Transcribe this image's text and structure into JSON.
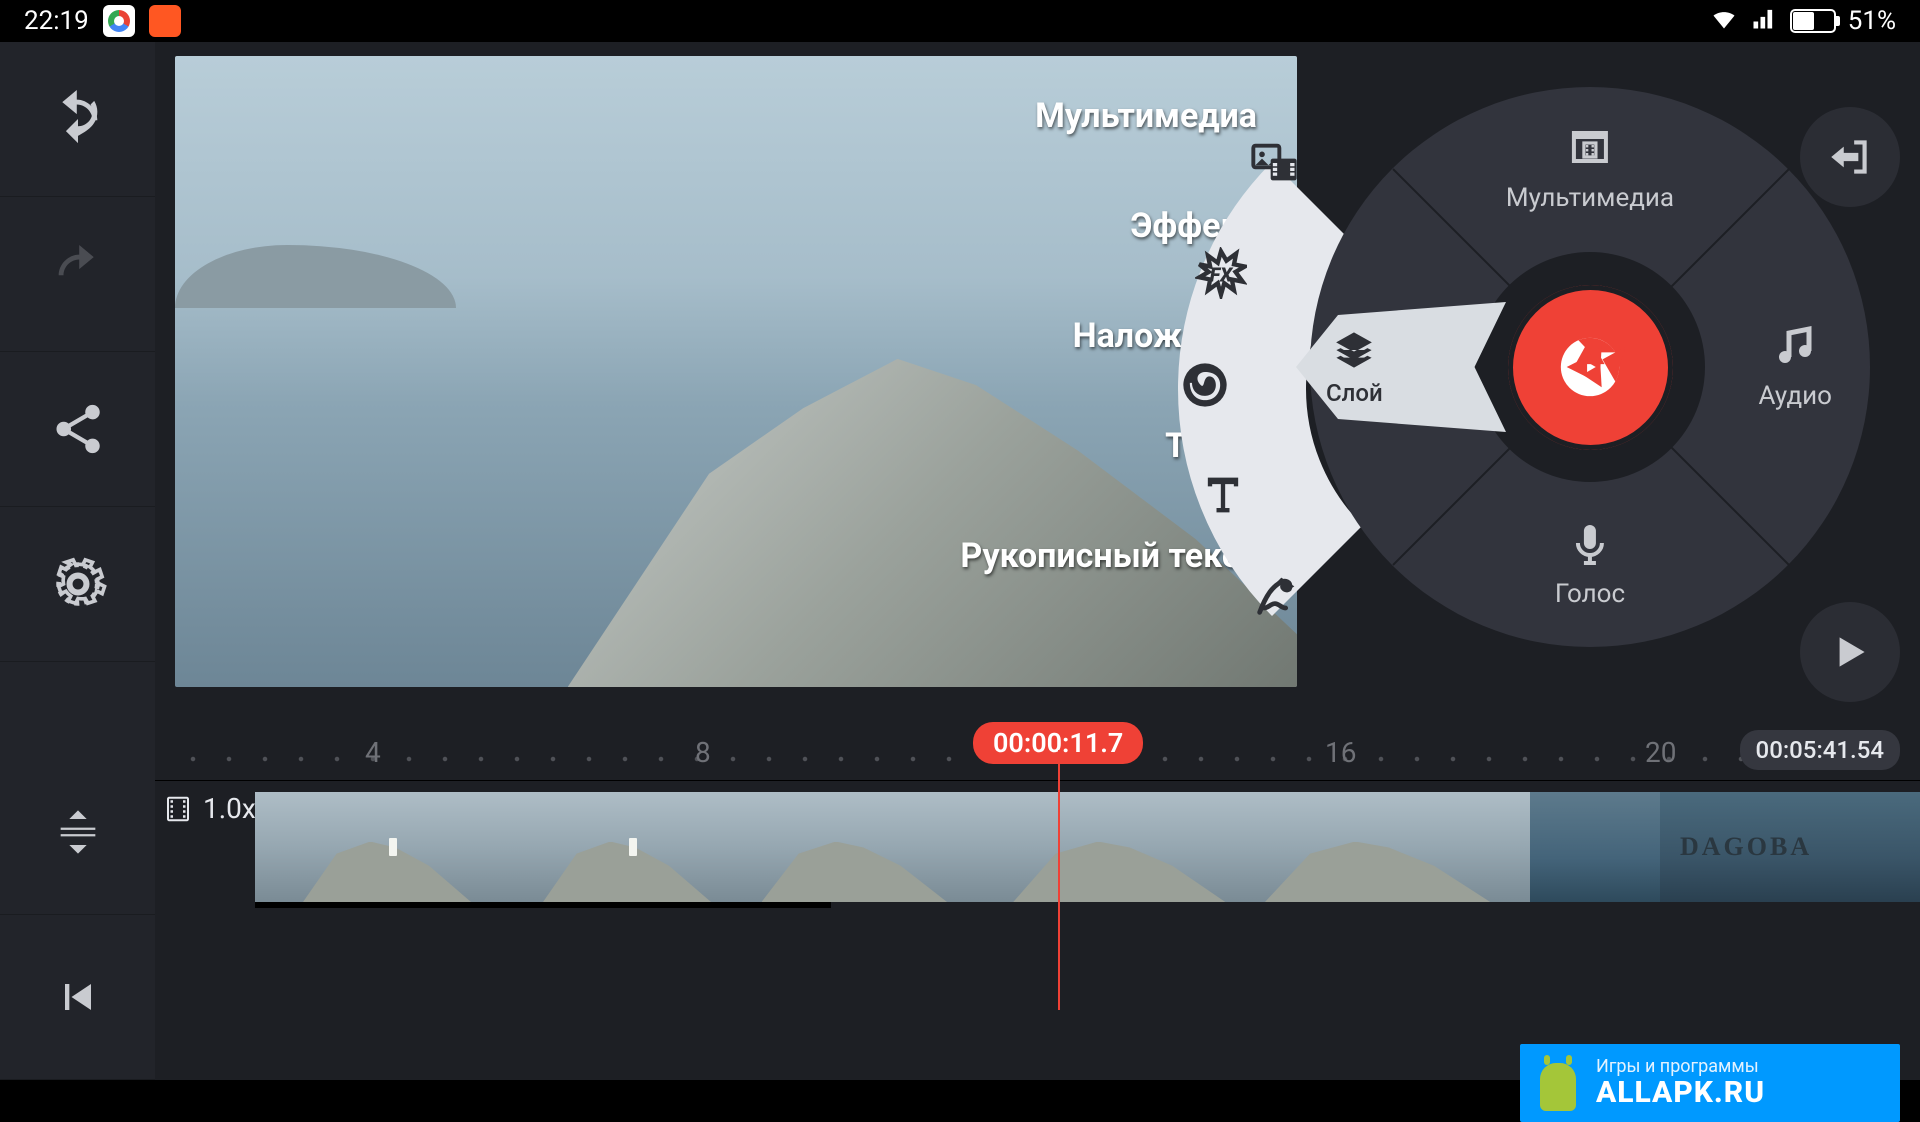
{
  "status_bar": {
    "time": "22:19",
    "battery": "51%"
  },
  "overlay_labels": {
    "multimedia": "Мультимедиа",
    "effect": "Эффект",
    "overlay": "Наложение",
    "text": "Текст",
    "handwriting": "Рукописный текст"
  },
  "wheel": {
    "multimedia": "Мультимедиа",
    "layer": "Слой",
    "audio": "Аудио",
    "voice": "Голос"
  },
  "timeline": {
    "ruler_marks": [
      "4",
      "8",
      "16",
      "20"
    ],
    "playhead_time": "00:00:11.7",
    "total_duration": "00:05:41.54",
    "speed": "1.0x"
  },
  "watermark": {
    "line1": "Игры и программы",
    "line2": "ALLAPK.RU"
  }
}
